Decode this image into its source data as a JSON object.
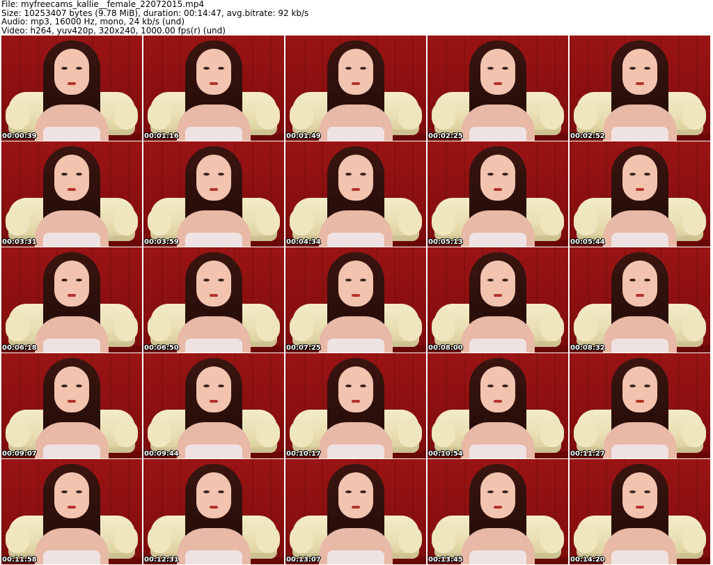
{
  "header": {
    "file_line": "File: myfreecams_kallie__female_22072015.mp4",
    "size_line": "Size: 10253407 bytes (9.78 MiB), duration: 00:14:47, avg.bitrate: 92 kb/s",
    "audio_line": "Audio: mp3, 16000 Hz, mono, 24 kb/s (und)",
    "video_line": "Video: h264, yuv420p, 320x240, 1000.00 fps(r) (und)"
  },
  "thumbnails": [
    {
      "timestamp": "00:00:39"
    },
    {
      "timestamp": "00:01:16"
    },
    {
      "timestamp": "00:01:49"
    },
    {
      "timestamp": "00:02:25"
    },
    {
      "timestamp": "00:02:52"
    },
    {
      "timestamp": "00:03:31"
    },
    {
      "timestamp": "00:03:59"
    },
    {
      "timestamp": "00:04:34"
    },
    {
      "timestamp": "00:05:13"
    },
    {
      "timestamp": "00:05:44"
    },
    {
      "timestamp": "00:06:18"
    },
    {
      "timestamp": "00:06:50"
    },
    {
      "timestamp": "00:07:25"
    },
    {
      "timestamp": "00:08:00"
    },
    {
      "timestamp": "00:08:32"
    },
    {
      "timestamp": "00:09:07"
    },
    {
      "timestamp": "00:09:44"
    },
    {
      "timestamp": "00:10:17"
    },
    {
      "timestamp": "00:10:54"
    },
    {
      "timestamp": "00:11:27"
    },
    {
      "timestamp": "00:11:58"
    },
    {
      "timestamp": "00:12:31"
    },
    {
      "timestamp": "00:13:07"
    },
    {
      "timestamp": "00:13:45"
    },
    {
      "timestamp": "00:14:20"
    }
  ],
  "colors": {
    "background": "#ffffff",
    "wall": "#8a0f10",
    "chair": "#efe6bd",
    "timestamp_text": "#ffffff"
  }
}
